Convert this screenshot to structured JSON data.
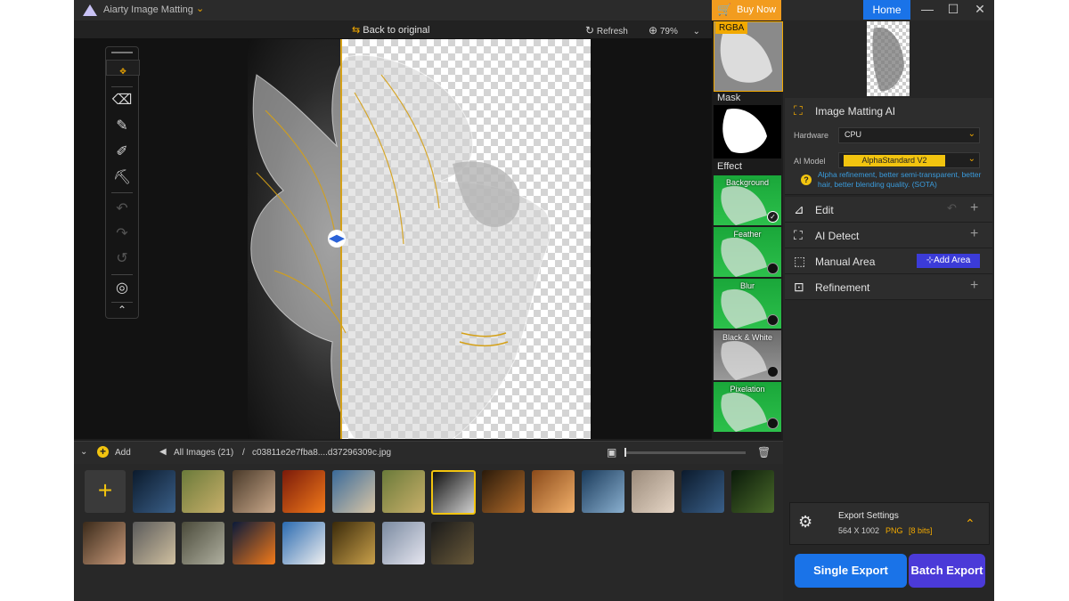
{
  "window": {
    "app_title": "Aiarty Image Matting",
    "buy_now": "Buy Now",
    "home": "Home",
    "controls": [
      "—",
      "☐",
      "✕"
    ]
  },
  "canvas_toolbar": {
    "back_to_original": "Back to original",
    "refresh": "Refresh",
    "zoom": "79%"
  },
  "left_tools": [
    "move-tool",
    "eraser-tool",
    "brush-tool",
    "paint-tool",
    "fill-tool",
    "undo",
    "redo",
    "reset",
    "mask-view",
    "collapse"
  ],
  "view_panel": {
    "rgba_label": "RGBA",
    "mask_label": "Mask",
    "effect_label": "Effect",
    "effects": [
      {
        "name": "Background",
        "selected": true
      },
      {
        "name": "Feather",
        "selected": false
      },
      {
        "name": "Blur",
        "selected": false
      },
      {
        "name": "Black & White",
        "selected": false
      },
      {
        "name": "Pixelation",
        "selected": false
      }
    ]
  },
  "right_panel": {
    "matting_title": "Image Matting AI",
    "hardware_label": "Hardware",
    "hardware_value": "CPU",
    "model_label": "AI Model",
    "model_value": "AlphaStandard  V2",
    "model_help": "Alpha refinement, better semi-transparent, better hair, better blending quality. (SOTA)",
    "edit": "Edit",
    "ai_detect": "AI Detect",
    "manual_area": "Manual Area",
    "add_area": "Add Area",
    "refinement": "Refinement",
    "export_settings": "Export Settings",
    "export_size": "564 X 1002",
    "export_format": "PNG",
    "export_bits": "[8 bits]",
    "single_export": "Single Export",
    "batch_export": "Batch Export"
  },
  "bottom_bar": {
    "add": "Add",
    "all_images": "All Images (21)",
    "sep": "/",
    "filename": "c03811e2e7fba8....d37296309c.jpg",
    "size_slider": 0.02
  },
  "colors": {
    "accent": "#f2a900",
    "blue": "#1a73e8",
    "purple": "#4b3ad8",
    "green": "#2cc04b"
  }
}
